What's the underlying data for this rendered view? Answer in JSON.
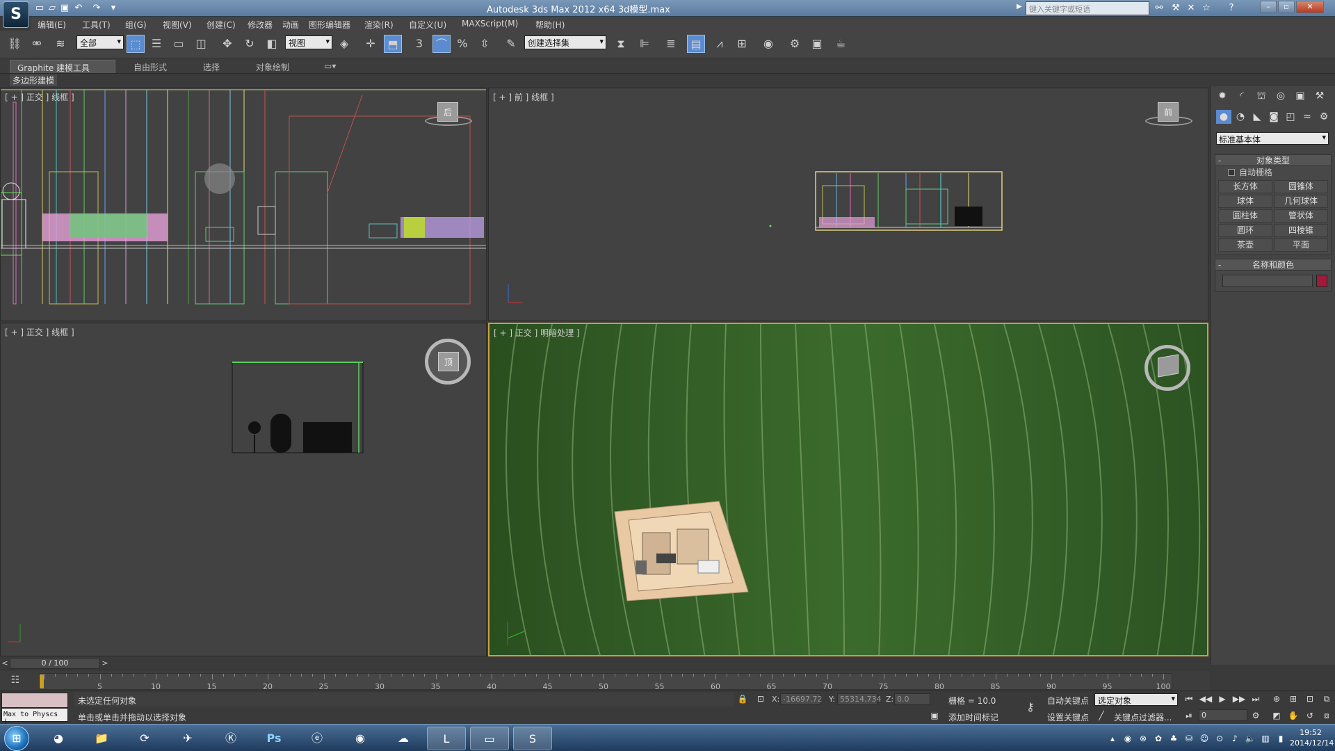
{
  "window": {
    "title": "Autodesk 3ds Max  2012 x64     3d模型.max",
    "search_placeholder": "键入关键字或短语"
  },
  "menu": [
    "编辑(E)",
    "工具(T)",
    "组(G)",
    "视图(V)",
    "创建(C)",
    "修改器",
    "动画",
    "图形编辑器",
    "渲染(R)",
    "自定义(U)",
    "MAXScript(M)",
    "帮助(H)"
  ],
  "toolbar": {
    "selection_filter": "全部",
    "coord_system": "视图",
    "named_selection": "创建选择集",
    "snap_label": "3"
  },
  "ribbon": {
    "tabs": [
      "Graphite 建模工具",
      "自由形式",
      "选择",
      "对象绘制"
    ],
    "active_tab": "Graphite 建模工具",
    "sub_label": "多边形建模"
  },
  "viewports": {
    "top_left": {
      "label": "[ + ] 正交 ] 线框 ]",
      "cube_face": "后"
    },
    "top_right": {
      "label": "[ + ] 前 ] 线框 ]",
      "cube_face": "前"
    },
    "bottom_left": {
      "label": "[ + ] 正交 ] 线框 ]",
      "cube_face": "顶"
    },
    "bottom_right": {
      "label": "[ + ] 正交 ] 明暗处理 ]"
    }
  },
  "command_panel": {
    "category": "标准基本体",
    "object_type_title": "对象类型",
    "autogrid": "自动栅格",
    "primitives": [
      "长方体",
      "圆锥体",
      "球体",
      "几何球体",
      "圆柱体",
      "管状体",
      "圆环",
      "四棱锥",
      "茶壶",
      "平面"
    ],
    "name_color_title": "名称和颜色",
    "swatch_color": "#a01a3a"
  },
  "timeline": {
    "frame_display": "0 / 100",
    "ticks": [
      "5",
      "10",
      "15",
      "20",
      "25",
      "30",
      "35",
      "40",
      "45",
      "50",
      "55",
      "60",
      "65",
      "70",
      "75",
      "80",
      "85",
      "90",
      "95",
      "100"
    ]
  },
  "status": {
    "maxscript": "Max to Physcs (",
    "selection_status": "未选定任何对象",
    "prompt": "单击或单击并拖动以选择对象",
    "x_label": "X:",
    "x_value": "-16697.72",
    "y_label": "Y:",
    "y_value": "55314.734",
    "z_label": "Z:",
    "z_value": "0.0",
    "grid": "栅格 = 10.0",
    "add_time_tag": "添加时间标记",
    "auto_key": "自动关键点",
    "set_key": "设置关键点",
    "key_mode": "选定对象",
    "key_filters": "关键点过滤器...",
    "current_frame": "0"
  },
  "taskbar": {
    "time": "19:52",
    "date": "2014/12/14"
  }
}
